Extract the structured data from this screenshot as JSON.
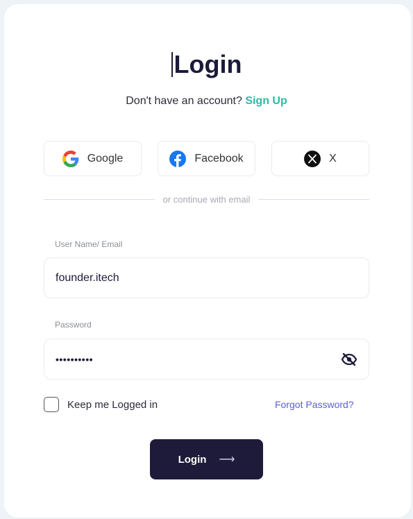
{
  "header": {
    "title": "Login",
    "prompt": "Don't have an account?",
    "signup_link": "Sign Up"
  },
  "social": {
    "google": {
      "label": "Google",
      "icon": "google-icon"
    },
    "facebook": {
      "label": "Facebook",
      "icon": "facebook-icon",
      "color": "#1877f2"
    },
    "x": {
      "label": "X",
      "icon": "x-icon"
    }
  },
  "divider": {
    "text": "or continue with email"
  },
  "form": {
    "username": {
      "label": "User Name/ Email",
      "value": "founder.itech"
    },
    "password": {
      "label": "Password",
      "value": "••••••••••",
      "icon": "eye-off-icon"
    },
    "remember_label": "Keep me Logged in",
    "forgot_label": "Forgot Password?",
    "submit_label": "Login",
    "submit_icon": "arrow-right-icon"
  },
  "colors": {
    "accent": "#2fb8a6",
    "primary_button": "#1e1b3a",
    "link": "#5a5fd4"
  }
}
